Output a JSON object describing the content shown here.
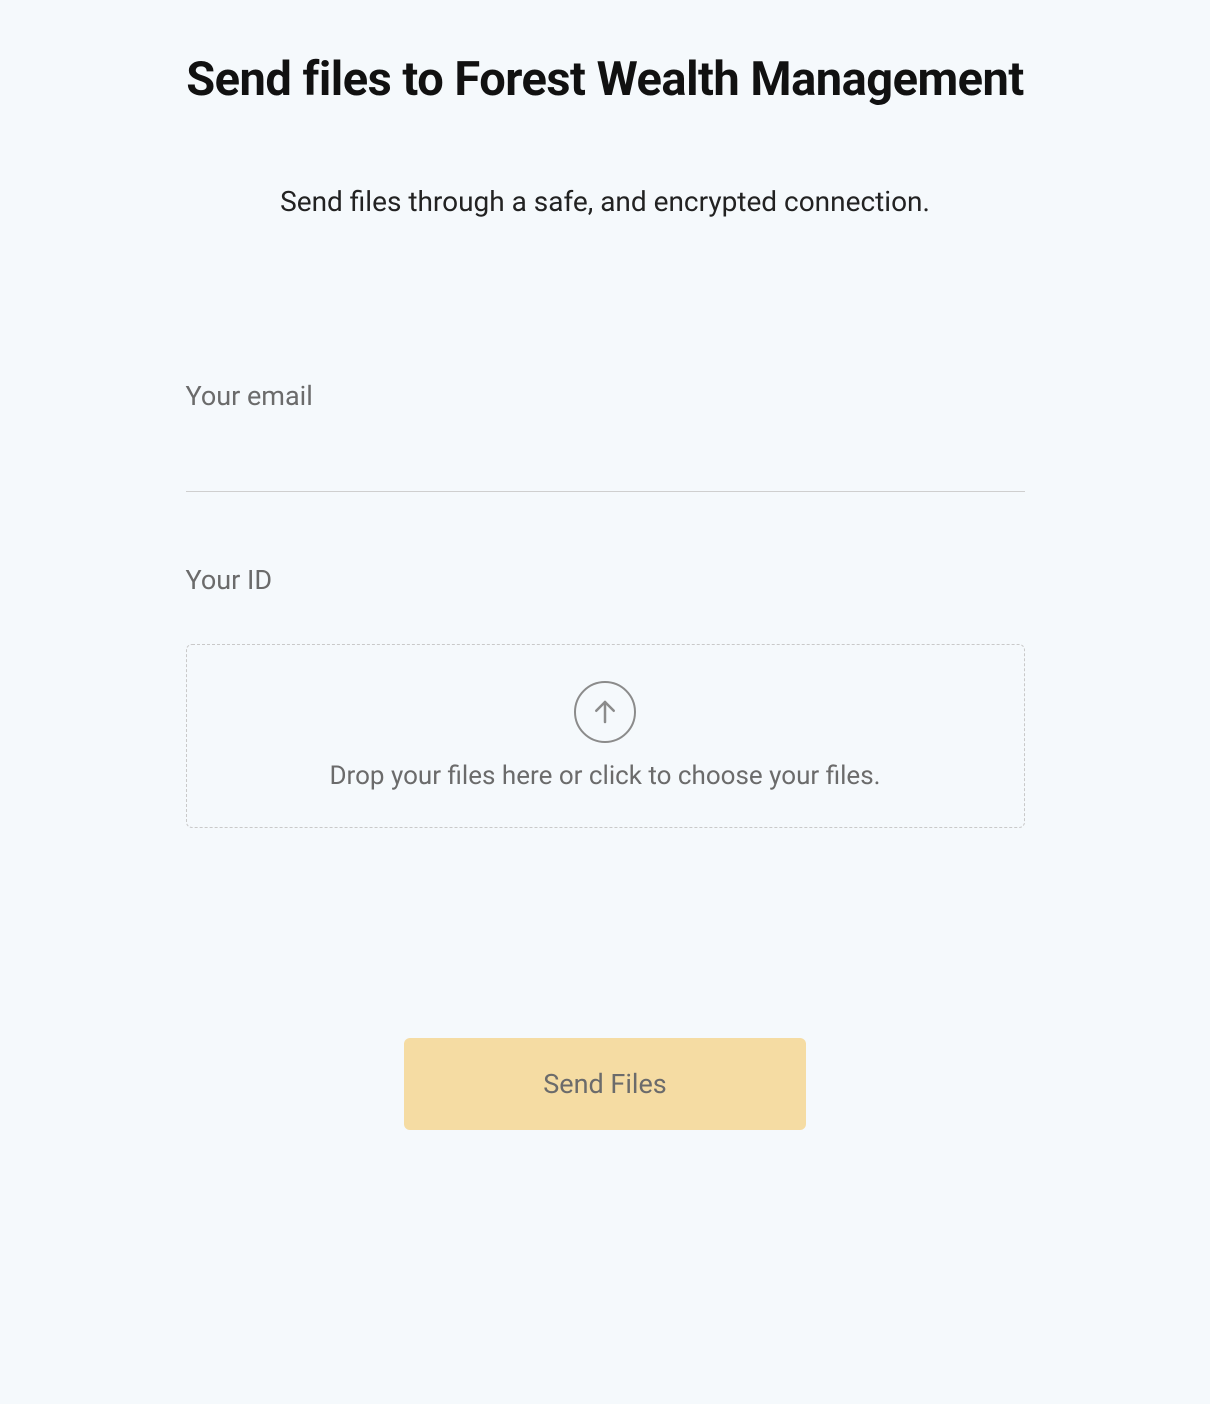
{
  "header": {
    "title": "Send files to Forest Wealth Management",
    "subtitle": "Send files through a safe, and encrypted connection."
  },
  "form": {
    "email": {
      "label": "Your email",
      "value": ""
    },
    "id_upload": {
      "label": "Your ID",
      "dropzone_text": "Drop your files here or click to choose your files."
    },
    "submit_label": "Send Files"
  }
}
